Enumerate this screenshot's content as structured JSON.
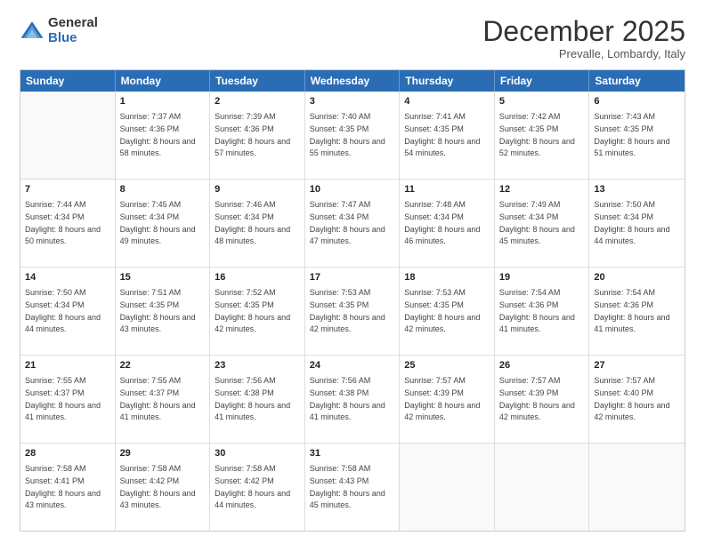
{
  "logo": {
    "general": "General",
    "blue": "Blue"
  },
  "title": "December 2025",
  "location": "Prevalle, Lombardy, Italy",
  "days_of_week": [
    "Sunday",
    "Monday",
    "Tuesday",
    "Wednesday",
    "Thursday",
    "Friday",
    "Saturday"
  ],
  "weeks": [
    [
      {
        "day": "",
        "empty": true
      },
      {
        "day": "1",
        "sunrise": "7:37 AM",
        "sunset": "4:36 PM",
        "daylight": "8 hours and 58 minutes."
      },
      {
        "day": "2",
        "sunrise": "7:39 AM",
        "sunset": "4:36 PM",
        "daylight": "8 hours and 57 minutes."
      },
      {
        "day": "3",
        "sunrise": "7:40 AM",
        "sunset": "4:35 PM",
        "daylight": "8 hours and 55 minutes."
      },
      {
        "day": "4",
        "sunrise": "7:41 AM",
        "sunset": "4:35 PM",
        "daylight": "8 hours and 54 minutes."
      },
      {
        "day": "5",
        "sunrise": "7:42 AM",
        "sunset": "4:35 PM",
        "daylight": "8 hours and 52 minutes."
      },
      {
        "day": "6",
        "sunrise": "7:43 AM",
        "sunset": "4:35 PM",
        "daylight": "8 hours and 51 minutes."
      }
    ],
    [
      {
        "day": "7",
        "sunrise": "7:44 AM",
        "sunset": "4:34 PM",
        "daylight": "8 hours and 50 minutes."
      },
      {
        "day": "8",
        "sunrise": "7:45 AM",
        "sunset": "4:34 PM",
        "daylight": "8 hours and 49 minutes."
      },
      {
        "day": "9",
        "sunrise": "7:46 AM",
        "sunset": "4:34 PM",
        "daylight": "8 hours and 48 minutes."
      },
      {
        "day": "10",
        "sunrise": "7:47 AM",
        "sunset": "4:34 PM",
        "daylight": "8 hours and 47 minutes."
      },
      {
        "day": "11",
        "sunrise": "7:48 AM",
        "sunset": "4:34 PM",
        "daylight": "8 hours and 46 minutes."
      },
      {
        "day": "12",
        "sunrise": "7:49 AM",
        "sunset": "4:34 PM",
        "daylight": "8 hours and 45 minutes."
      },
      {
        "day": "13",
        "sunrise": "7:50 AM",
        "sunset": "4:34 PM",
        "daylight": "8 hours and 44 minutes."
      }
    ],
    [
      {
        "day": "14",
        "sunrise": "7:50 AM",
        "sunset": "4:34 PM",
        "daylight": "8 hours and 44 minutes."
      },
      {
        "day": "15",
        "sunrise": "7:51 AM",
        "sunset": "4:35 PM",
        "daylight": "8 hours and 43 minutes."
      },
      {
        "day": "16",
        "sunrise": "7:52 AM",
        "sunset": "4:35 PM",
        "daylight": "8 hours and 42 minutes."
      },
      {
        "day": "17",
        "sunrise": "7:53 AM",
        "sunset": "4:35 PM",
        "daylight": "8 hours and 42 minutes."
      },
      {
        "day": "18",
        "sunrise": "7:53 AM",
        "sunset": "4:35 PM",
        "daylight": "8 hours and 42 minutes."
      },
      {
        "day": "19",
        "sunrise": "7:54 AM",
        "sunset": "4:36 PM",
        "daylight": "8 hours and 41 minutes."
      },
      {
        "day": "20",
        "sunrise": "7:54 AM",
        "sunset": "4:36 PM",
        "daylight": "8 hours and 41 minutes."
      }
    ],
    [
      {
        "day": "21",
        "sunrise": "7:55 AM",
        "sunset": "4:37 PM",
        "daylight": "8 hours and 41 minutes."
      },
      {
        "day": "22",
        "sunrise": "7:55 AM",
        "sunset": "4:37 PM",
        "daylight": "8 hours and 41 minutes."
      },
      {
        "day": "23",
        "sunrise": "7:56 AM",
        "sunset": "4:38 PM",
        "daylight": "8 hours and 41 minutes."
      },
      {
        "day": "24",
        "sunrise": "7:56 AM",
        "sunset": "4:38 PM",
        "daylight": "8 hours and 41 minutes."
      },
      {
        "day": "25",
        "sunrise": "7:57 AM",
        "sunset": "4:39 PM",
        "daylight": "8 hours and 42 minutes."
      },
      {
        "day": "26",
        "sunrise": "7:57 AM",
        "sunset": "4:39 PM",
        "daylight": "8 hours and 42 minutes."
      },
      {
        "day": "27",
        "sunrise": "7:57 AM",
        "sunset": "4:40 PM",
        "daylight": "8 hours and 42 minutes."
      }
    ],
    [
      {
        "day": "28",
        "sunrise": "7:58 AM",
        "sunset": "4:41 PM",
        "daylight": "8 hours and 43 minutes."
      },
      {
        "day": "29",
        "sunrise": "7:58 AM",
        "sunset": "4:42 PM",
        "daylight": "8 hours and 43 minutes."
      },
      {
        "day": "30",
        "sunrise": "7:58 AM",
        "sunset": "4:42 PM",
        "daylight": "8 hours and 44 minutes."
      },
      {
        "day": "31",
        "sunrise": "7:58 AM",
        "sunset": "4:43 PM",
        "daylight": "8 hours and 45 minutes."
      },
      {
        "day": "",
        "empty": true
      },
      {
        "day": "",
        "empty": true
      },
      {
        "day": "",
        "empty": true
      }
    ]
  ]
}
